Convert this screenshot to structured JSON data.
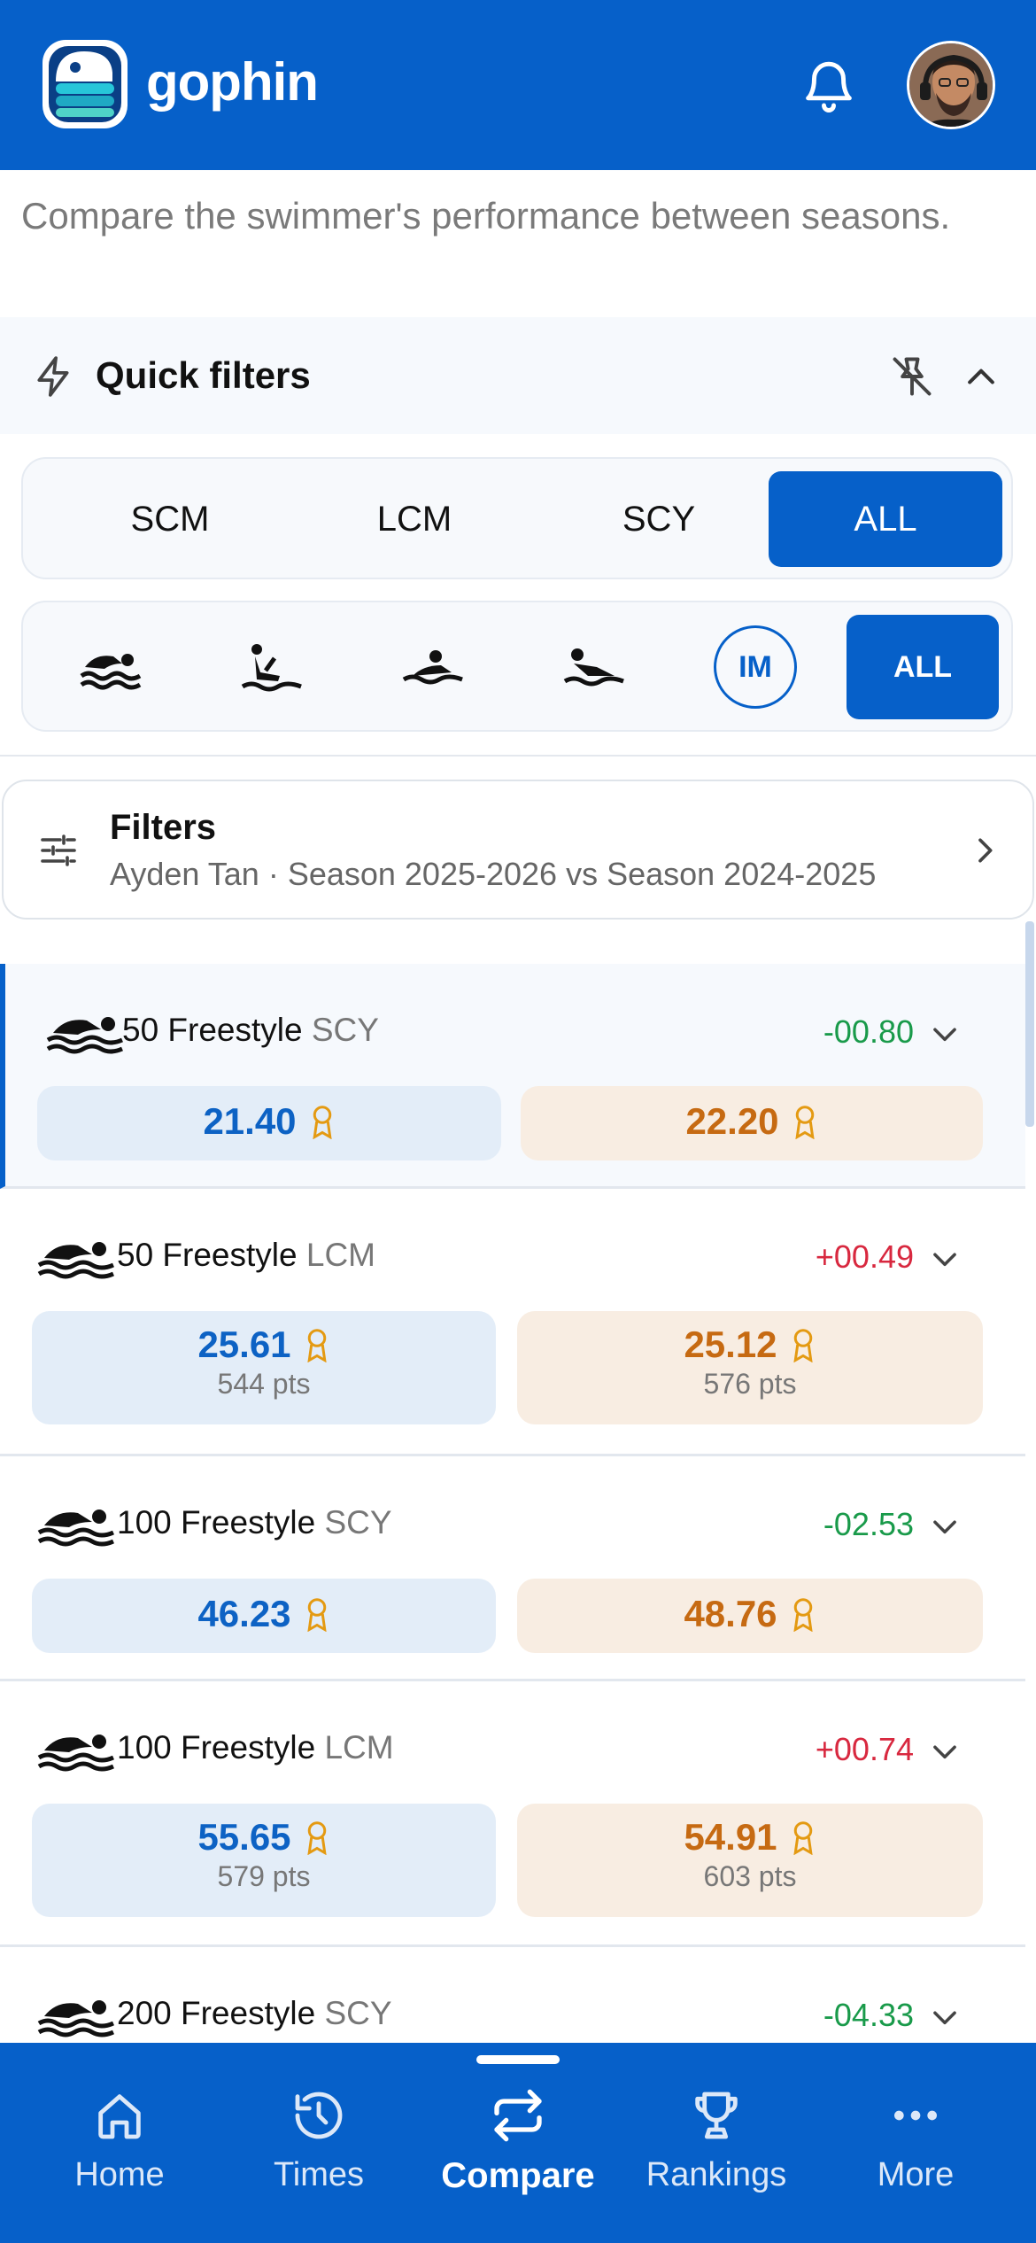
{
  "app": {
    "brand": "gophin"
  },
  "intro": "Compare the swimmer's performance between seasons.",
  "quick_filters": {
    "title": "Quick filters",
    "courses": [
      {
        "label": "SCM",
        "active": false
      },
      {
        "label": "LCM",
        "active": false
      },
      {
        "label": "SCY",
        "active": false
      },
      {
        "label": "ALL",
        "active": true
      }
    ],
    "strokes": [
      {
        "icon": "freestyle-icon"
      },
      {
        "icon": "backstroke-icon"
      },
      {
        "icon": "breaststroke-icon"
      },
      {
        "icon": "butterfly-icon"
      },
      {
        "label": "IM"
      },
      {
        "label": "ALL",
        "active": true
      }
    ]
  },
  "filters": {
    "title": "Filters",
    "summary": "Ayden Tan · Season 2025-2026 vs Season 2024-2025"
  },
  "events": [
    {
      "name": "50 Freestyle",
      "course": "SCY",
      "diff": "-00.80",
      "current": {
        "time": "21.40",
        "pts": ""
      },
      "previous": {
        "time": "22.20",
        "pts": ""
      }
    },
    {
      "name": "50 Freestyle",
      "course": "LCM",
      "diff": "+00.49",
      "current": {
        "time": "25.61",
        "pts": "544 pts"
      },
      "previous": {
        "time": "25.12",
        "pts": "576 pts"
      }
    },
    {
      "name": "100 Freestyle",
      "course": "SCY",
      "diff": "-02.53",
      "current": {
        "time": "46.23",
        "pts": ""
      },
      "previous": {
        "time": "48.76",
        "pts": ""
      }
    },
    {
      "name": "100 Freestyle",
      "course": "LCM",
      "diff": "+00.74",
      "current": {
        "time": "55.65",
        "pts": "579 pts"
      },
      "previous": {
        "time": "54.91",
        "pts": "603 pts"
      }
    },
    {
      "name": "200 Freestyle",
      "course": "SCY",
      "diff": "-04.33"
    }
  ],
  "nav": {
    "items": [
      {
        "label": "Home",
        "icon": "home-icon"
      },
      {
        "label": "Times",
        "icon": "history-icon"
      },
      {
        "label": "Compare",
        "icon": "compare-icon",
        "active": true
      },
      {
        "label": "Rankings",
        "icon": "trophy-icon"
      },
      {
        "label": "More",
        "icon": "more-icon"
      }
    ]
  },
  "colors": {
    "primary": "#0660c9",
    "negative_diff": "#199a4a",
    "positive_diff": "#d8283f"
  }
}
